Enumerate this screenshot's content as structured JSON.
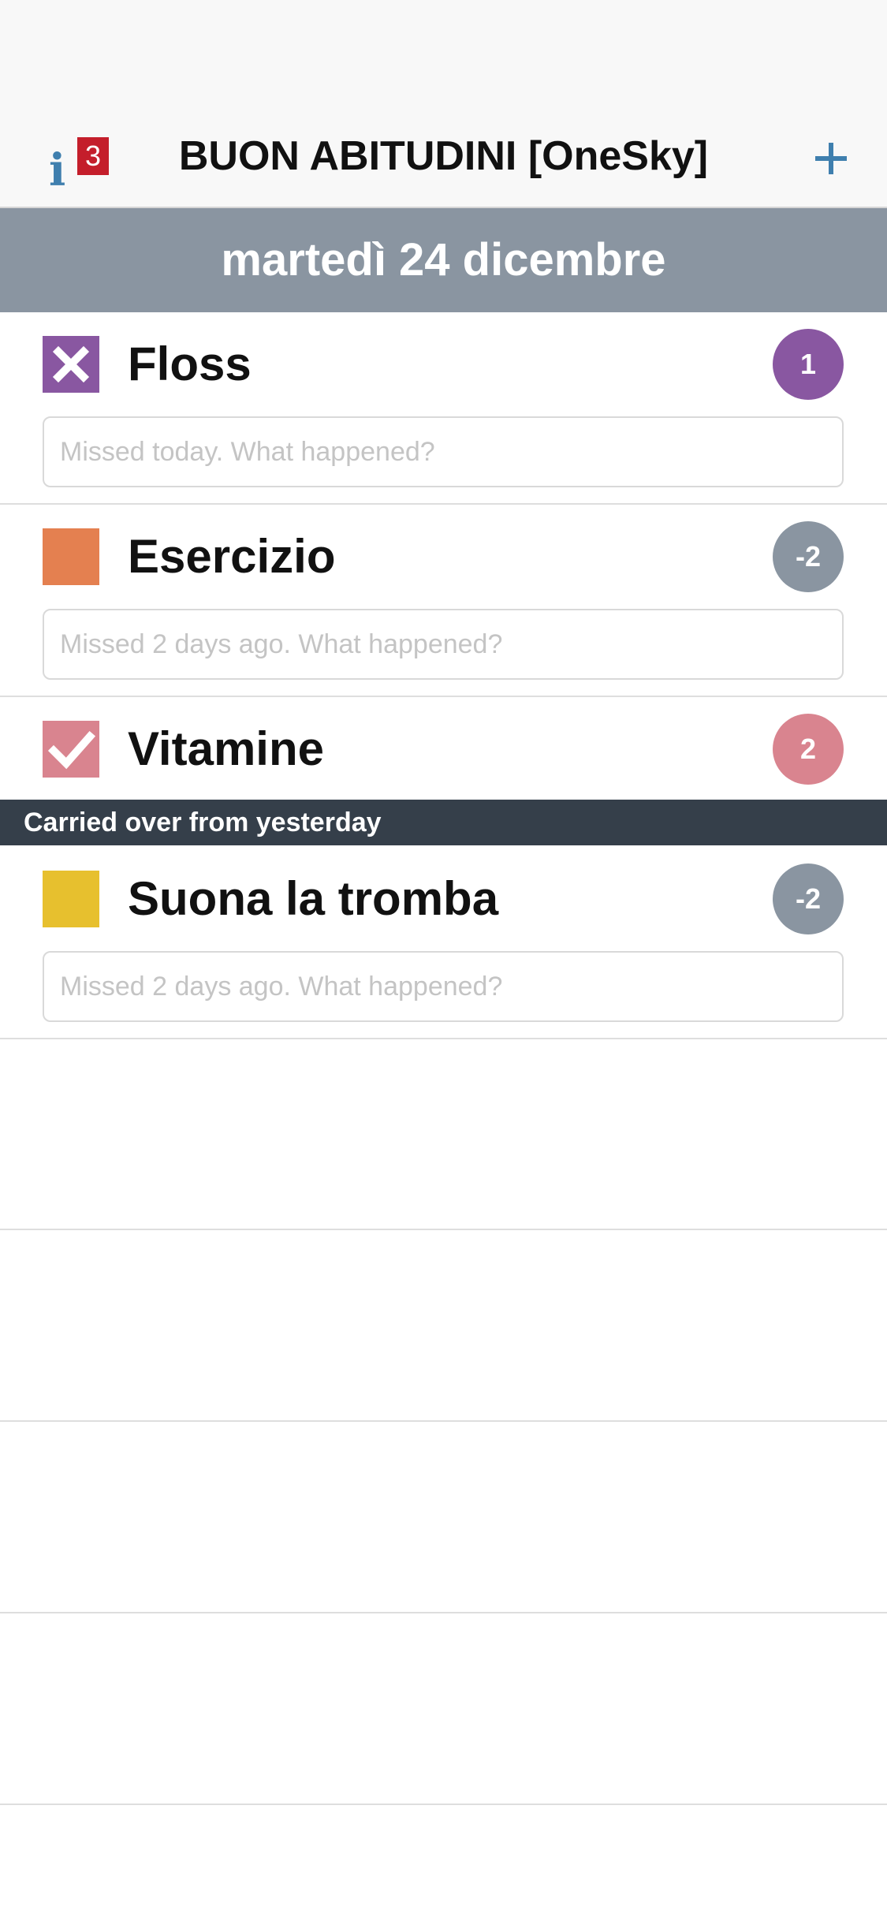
{
  "nav": {
    "title": "BUON ABITUDINI [OneSky]",
    "info_glyph": "i",
    "info_badge": "3",
    "add_icon": "plus-icon"
  },
  "date_header": "martedì 24 dicembre",
  "colors": {
    "accent": "#3f7fae",
    "badge_red": "#c41e2b",
    "date_header_bg": "#8a95a1",
    "section_header_bg": "#353f4a",
    "streak_negative": "#8a95a1"
  },
  "habits": [
    {
      "name": "Floss",
      "status": "missed",
      "check_icon": "x-mark-icon",
      "color": "#8957a1",
      "streak": "1",
      "streak_color": "#8957a1",
      "note_placeholder": "Missed today. What happened?"
    },
    {
      "name": "Esercizio",
      "status": "unchecked",
      "check_icon": "empty-box-icon",
      "color": "#e48050",
      "streak": "-2",
      "streak_color": "#8a95a1",
      "note_placeholder": "Missed 2 days ago. What happened?"
    },
    {
      "name": "Vitamine",
      "status": "done",
      "check_icon": "checkmark-icon",
      "color": "#d9848f",
      "streak": "2",
      "streak_color": "#d9848f"
    }
  ],
  "carried_over": {
    "header": "Carried over from yesterday",
    "habits": [
      {
        "name": "Suona la tromba",
        "status": "unchecked",
        "check_icon": "empty-box-icon",
        "color": "#e7c02e",
        "streak": "-2",
        "streak_color": "#8a95a1",
        "note_placeholder": "Missed 2 days ago. What happened?"
      }
    ]
  }
}
